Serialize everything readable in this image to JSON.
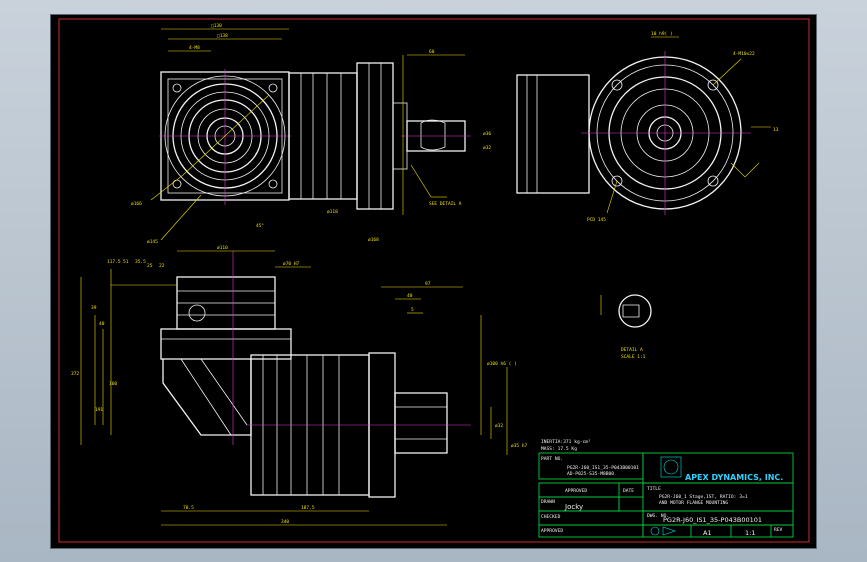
{
  "title_block": {
    "inertia": "INERTIA:371 kg-cm²",
    "mass": "MASS: 17.5 Kg",
    "part_no_label": "PART NO.",
    "part_no_1": "PG2R-J60_IS1_35-P043B00101",
    "part_no_2": "AD-P025-S35-M8B00",
    "title_label": "TITLE",
    "title_line1": "PG2R-J60_1 Stage,1ST,  RATIO: 3=1",
    "title_line2": "AND MOTOR FLANGE MOUNTING",
    "approved_label": "APPROVED",
    "date_label": "DATE",
    "drawn_label": "DRAWN",
    "drawn_by": "Jocky",
    "checked_label": "CHECKED",
    "dwg_no_label": "DWG. NO.",
    "dwg_no": "PG2R-J60_IS1_35-P043B00101",
    "approved2_label": "APPROVED",
    "size_value": "A1",
    "scale_value": "1:1",
    "rev_label": "REV",
    "company": "APEX DYNAMICS, INC."
  },
  "labels": {
    "see_detail": "SEE DETAIL A",
    "detail_title": "DETAIL A",
    "detail_scale": "SCALE 1:1",
    "pcd": "PCD 145",
    "bolt_holes": "4-M10x22"
  },
  "dimensions": {
    "top_w1": "□130",
    "top_w2": "□138",
    "top_d1": "4-M8",
    "top_len": "60",
    "top_dia_a": "ø166",
    "top_dia_b": "ø145",
    "top_dia_c": "ø118",
    "top_dia_d": "ø168",
    "top_ang": "45°",
    "shaft_d1": "ø36",
    "shaft_d2": "ø32",
    "right_key": "10 h9(  )",
    "right_dim": "13",
    "left_h1": "117.5",
    "left_h2": "51",
    "left_h3": "35.5",
    "left_h4": "25",
    "left_h5": "22",
    "left_w_top": "ø110",
    "left_fit": "ø70 H7",
    "left_v1": "39",
    "left_v2": "40",
    "left_v3": "160",
    "left_v4": "191",
    "left_total": "372",
    "bottom_1": "78.5",
    "bottom_2": "187.5",
    "bottom_3": "340",
    "right_97": "97",
    "right_40": "40",
    "right_5": "5",
    "right_fit": "ø100 h6 (  )",
    "right_shaft": "ø32",
    "right_shaft2": "ø35 h7"
  }
}
